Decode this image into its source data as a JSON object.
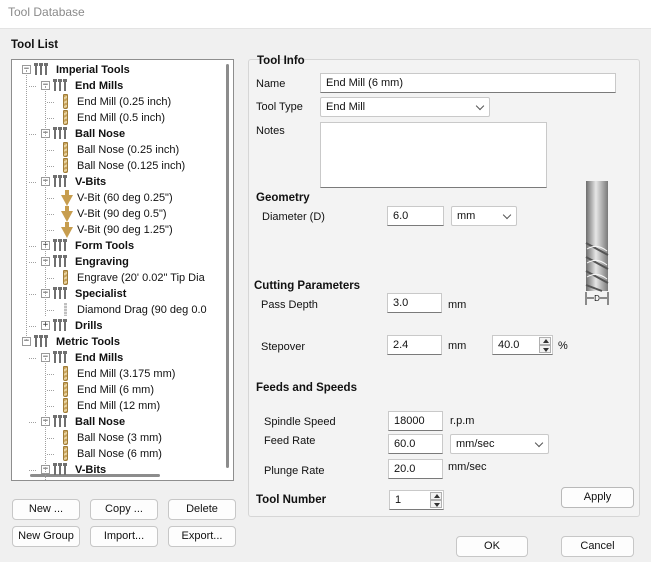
{
  "window": {
    "title": "Tool Database"
  },
  "tool_list": {
    "heading": "Tool List",
    "tree": [
      {
        "label": "Imperial Tools",
        "level": 0,
        "kind": "group",
        "expanded": true
      },
      {
        "label": "End Mills",
        "level": 1,
        "kind": "group",
        "expanded": true
      },
      {
        "label": "End Mill (0.25 inch)",
        "level": 2,
        "kind": "endmill"
      },
      {
        "label": "End Mill (0.5 inch)",
        "level": 2,
        "kind": "endmill"
      },
      {
        "label": "Ball Nose",
        "level": 1,
        "kind": "group",
        "expanded": true
      },
      {
        "label": "Ball Nose (0.25 inch)",
        "level": 2,
        "kind": "ballnose"
      },
      {
        "label": "Ball Nose (0.125 inch)",
        "level": 2,
        "kind": "ballnose"
      },
      {
        "label": "V-Bits",
        "level": 1,
        "kind": "group",
        "expanded": true
      },
      {
        "label": "V-Bit (60 deg 0.25\")",
        "level": 2,
        "kind": "vbit"
      },
      {
        "label": "V-Bit (90 deg 0.5\")",
        "level": 2,
        "kind": "vbit"
      },
      {
        "label": "V-Bit (90 deg 1.25\")",
        "level": 2,
        "kind": "vbit"
      },
      {
        "label": "Form Tools",
        "level": 1,
        "kind": "group",
        "expanded": false
      },
      {
        "label": "Engraving",
        "level": 1,
        "kind": "group",
        "expanded": true
      },
      {
        "label": "Engrave (20' 0.02\" Tip Dia",
        "level": 2,
        "kind": "engrave"
      },
      {
        "label": "Specialist",
        "level": 1,
        "kind": "group",
        "expanded": true
      },
      {
        "label": "Diamond Drag (90 deg 0.0",
        "level": 2,
        "kind": "drag"
      },
      {
        "label": "Drills",
        "level": 1,
        "kind": "group",
        "expanded": false
      },
      {
        "label": "Metric Tools",
        "level": 0,
        "kind": "group",
        "expanded": true
      },
      {
        "label": "End Mills",
        "level": 1,
        "kind": "group",
        "expanded": true
      },
      {
        "label": "End Mill (3.175 mm)",
        "level": 2,
        "kind": "endmill"
      },
      {
        "label": "End Mill (6 mm)",
        "level": 2,
        "kind": "endmill"
      },
      {
        "label": "End Mill (12 mm)",
        "level": 2,
        "kind": "endmill"
      },
      {
        "label": "Ball Nose",
        "level": 1,
        "kind": "group",
        "expanded": true
      },
      {
        "label": "Ball Nose (3 mm)",
        "level": 2,
        "kind": "ballnose"
      },
      {
        "label": "Ball Nose (6 mm)",
        "level": 2,
        "kind": "ballnose"
      },
      {
        "label": "V-Bits",
        "level": 1,
        "kind": "group",
        "expanded": true
      }
    ],
    "buttons": {
      "new": "New ...",
      "copy": "Copy ...",
      "delete": "Delete",
      "new_group": "New Group",
      "import": "Import...",
      "export": "Export..."
    }
  },
  "tool_info": {
    "heading": "Tool Info",
    "name_label": "Name",
    "name_value": "End Mill (6 mm)",
    "type_label": "Tool Type",
    "type_value": "End Mill",
    "notes_label": "Notes",
    "notes_value": ""
  },
  "geometry": {
    "heading": "Geometry",
    "diameter_label": "Diameter (D)",
    "diameter_value": "6.0",
    "units_value": "mm",
    "diagram_label": "D"
  },
  "cutting": {
    "heading": "Cutting Parameters",
    "pass_depth_label": "Pass Depth",
    "pass_depth_value": "3.0",
    "pass_depth_unit": "mm",
    "stepover_label": "Stepover",
    "stepover_value": "2.4",
    "stepover_unit": "mm",
    "stepover_pct_value": "40.0",
    "stepover_pct_unit": "%"
  },
  "feeds": {
    "heading": "Feeds and Speeds",
    "spindle_label": "Spindle Speed",
    "spindle_value": "18000",
    "spindle_unit": "r.p.m",
    "feed_label": "Feed Rate",
    "feed_value": "60.0",
    "feed_unit_value": "mm/sec",
    "plunge_label": "Plunge Rate",
    "plunge_value": "20.0",
    "plunge_unit": "mm/sec"
  },
  "tool_number": {
    "label": "Tool Number",
    "value": "1"
  },
  "actions": {
    "apply": "Apply",
    "ok": "OK",
    "cancel": "Cancel"
  },
  "colors": {
    "window_bg": "#f0f0f0",
    "panel_bg": "#f3f3f3",
    "tool_gold": "#c9a35b"
  }
}
